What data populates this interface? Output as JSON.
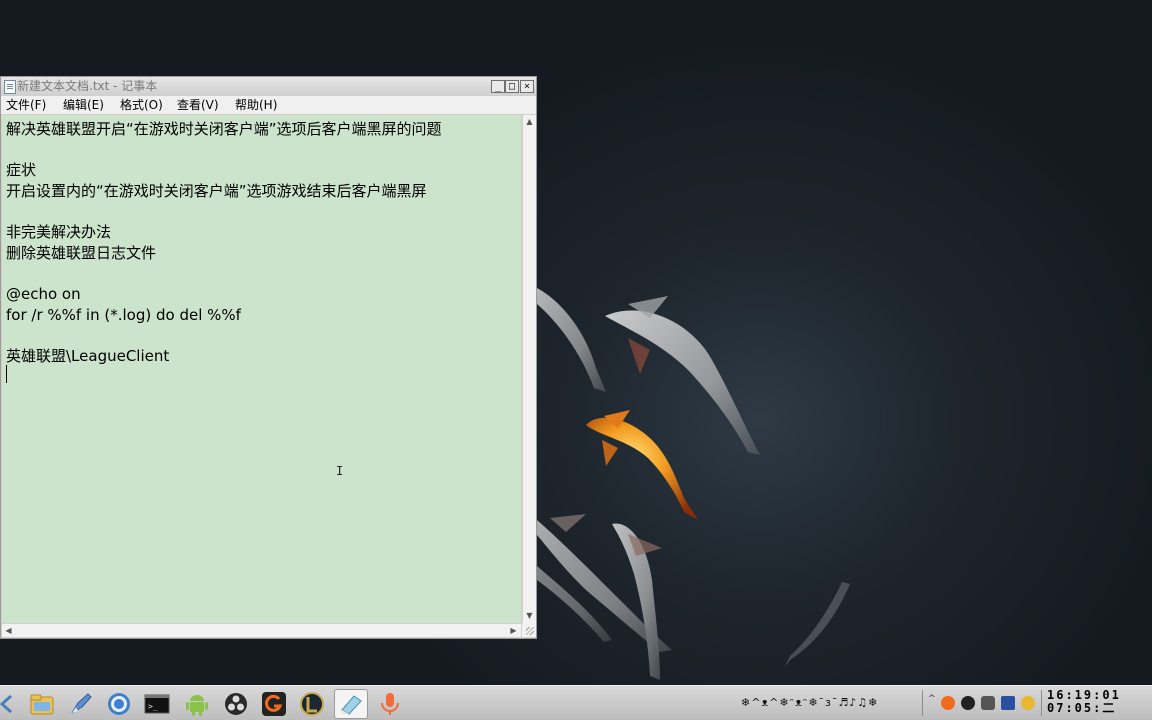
{
  "window": {
    "title": "新建文本文档.txt - 记事本",
    "min_glyph": "_",
    "max_glyph": "□",
    "close_glyph": "×"
  },
  "menu": {
    "file": "文件(F)",
    "edit": "编辑(E)",
    "format": "格式(O)",
    "view": "查看(V)",
    "help": "帮助(H)"
  },
  "document": {
    "lines": [
      "解决英雄联盟开启“在游戏时关闭客户端”选项后客户端黑屏的问题",
      "",
      "症状",
      "开启设置内的“在游戏时关闭客户端”选项游戏结束后客户端黑屏",
      "",
      "非完美解决办法",
      "删除英雄联盟日志文件",
      "",
      "@echo on",
      "for /r %%f in (*.log) do del %%f",
      "",
      "英雄联盟\\LeagueClient"
    ]
  },
  "taskbar": {
    "apps": [
      {
        "name": "file-manager",
        "icon": "folder-icon"
      },
      {
        "name": "browser-launcher",
        "icon": "rocket-icon"
      },
      {
        "name": "chrome",
        "icon": "chrome-icon"
      },
      {
        "name": "terminal",
        "icon": "terminal-icon"
      },
      {
        "name": "android",
        "icon": "android-icon"
      },
      {
        "name": "obs",
        "icon": "obs-icon"
      },
      {
        "name": "g-app",
        "icon": "g-app-icon"
      },
      {
        "name": "league-of-legends",
        "icon": "lol-icon"
      },
      {
        "name": "notepad",
        "icon": "notepad-icon"
      },
      {
        "name": "microphone",
        "icon": "microphone-icon"
      }
    ],
    "tray_text": "❄^ᴥ^❄ᵔᴥᵔ❄ˉɜˉ♬♪♫❄",
    "clock_time": "16:19:01",
    "clock_date": "07:05:二"
  },
  "colors": {
    "editor_bg": "#cce3cc",
    "accent_fish": "#f39a1f"
  }
}
